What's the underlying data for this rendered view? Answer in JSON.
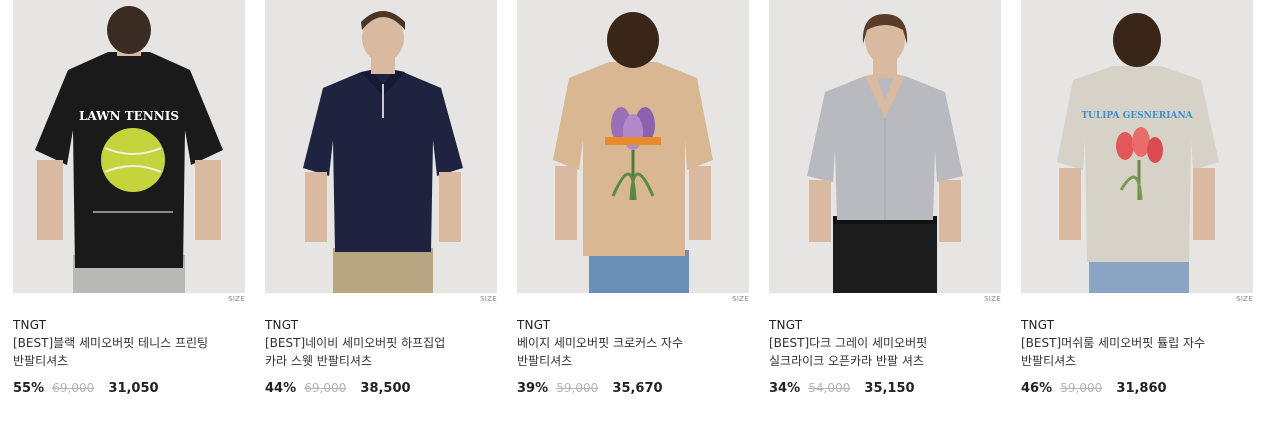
{
  "products": [
    {
      "image_alt": "black tennis print t-shirt back view",
      "size_label": "SIZE",
      "brand": "TNGT",
      "name": "[BEST]블랙 세미오버핏 테니스 프린팅 반팔티셔츠",
      "discount": "55%",
      "original_price": "69,000",
      "sale_price": "31,050",
      "print_text": "LAWN TENNIS",
      "shirt_color": "#1a1a1a"
    },
    {
      "image_alt": "navy half zip collar knit front view",
      "size_label": "SIZE",
      "brand": "TNGT",
      "name": "[BEST]네이비 세미오버핏 하프집업 카라 스웻 반팔티셔츠",
      "discount": "44%",
      "original_price": "69,000",
      "sale_price": "38,500",
      "shirt_color": "#1e2340"
    },
    {
      "image_alt": "beige crocus embroidery t-shirt back view",
      "size_label": "SIZE",
      "brand": "TNGT",
      "name": "베이지 세미오버핏 크로커스 자수 반팔티셔츠",
      "discount": "39%",
      "original_price": "59,000",
      "sale_price": "35,670",
      "shirt_color": "#d8b792"
    },
    {
      "image_alt": "dark gray open collar short sleeve shirt",
      "size_label": "SIZE",
      "brand": "TNGT",
      "name": "[BEST]다크 그레이 세미오버핏 실크라이크 오픈카라 반팔 셔츠",
      "discount": "34%",
      "original_price": "54,000",
      "sale_price": "35,150",
      "shirt_color": "#b9bac0"
    },
    {
      "image_alt": "mushroom tulip embroidery t-shirt back view",
      "size_label": "SIZE",
      "brand": "TNGT",
      "name": "[BEST]머쉬룸 세미오버핏 튤립 자수 반팔티셔츠",
      "discount": "46%",
      "original_price": "59,000",
      "sale_price": "31,860",
      "print_text": "TULIPA GESNERIANA",
      "shirt_color": "#d6d2c7"
    }
  ]
}
